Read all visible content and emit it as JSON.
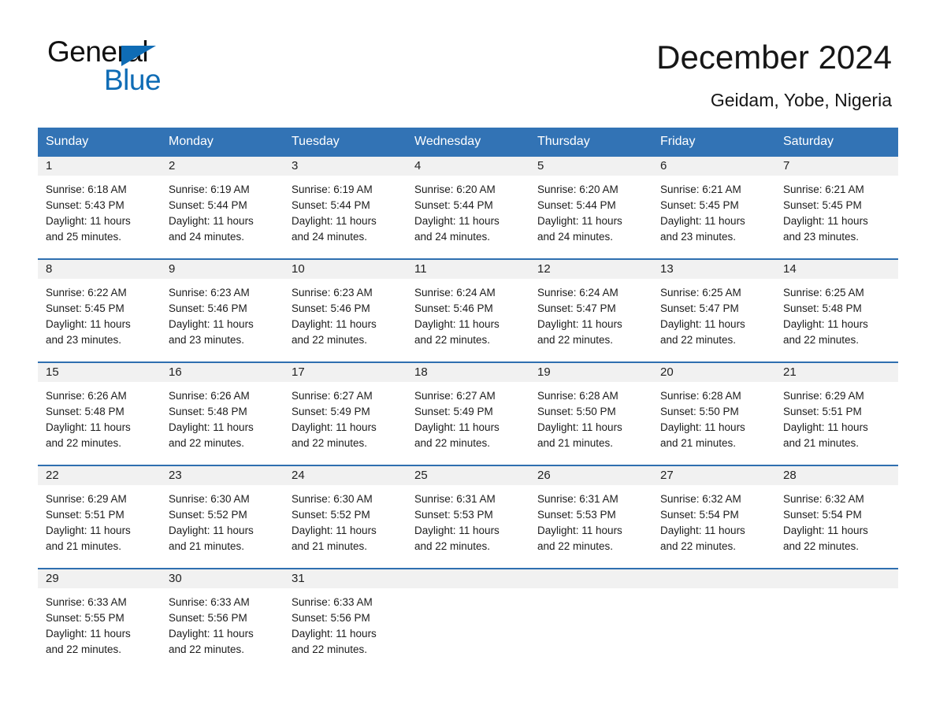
{
  "brand": {
    "name_part1": "General",
    "name_part2": "Blue",
    "accent_color": "#0f6cb5"
  },
  "header": {
    "title": "December 2024",
    "subtitle": "Geidam, Yobe, Nigeria"
  },
  "calendar": {
    "header_bg": "#3273b5",
    "header_text_color": "#ffffff",
    "row_border_color": "#2f6fb0",
    "daynum_bg": "#f1f1f1",
    "weekdays": [
      "Sunday",
      "Monday",
      "Tuesday",
      "Wednesday",
      "Thursday",
      "Friday",
      "Saturday"
    ],
    "weeks": [
      [
        {
          "day": "1",
          "sunrise": "Sunrise: 6:18 AM",
          "sunset": "Sunset: 5:43 PM",
          "daylight_1": "Daylight: 11 hours",
          "daylight_2": "and 25 minutes."
        },
        {
          "day": "2",
          "sunrise": "Sunrise: 6:19 AM",
          "sunset": "Sunset: 5:44 PM",
          "daylight_1": "Daylight: 11 hours",
          "daylight_2": "and 24 minutes."
        },
        {
          "day": "3",
          "sunrise": "Sunrise: 6:19 AM",
          "sunset": "Sunset: 5:44 PM",
          "daylight_1": "Daylight: 11 hours",
          "daylight_2": "and 24 minutes."
        },
        {
          "day": "4",
          "sunrise": "Sunrise: 6:20 AM",
          "sunset": "Sunset: 5:44 PM",
          "daylight_1": "Daylight: 11 hours",
          "daylight_2": "and 24 minutes."
        },
        {
          "day": "5",
          "sunrise": "Sunrise: 6:20 AM",
          "sunset": "Sunset: 5:44 PM",
          "daylight_1": "Daylight: 11 hours",
          "daylight_2": "and 24 minutes."
        },
        {
          "day": "6",
          "sunrise": "Sunrise: 6:21 AM",
          "sunset": "Sunset: 5:45 PM",
          "daylight_1": "Daylight: 11 hours",
          "daylight_2": "and 23 minutes."
        },
        {
          "day": "7",
          "sunrise": "Sunrise: 6:21 AM",
          "sunset": "Sunset: 5:45 PM",
          "daylight_1": "Daylight: 11 hours",
          "daylight_2": "and 23 minutes."
        }
      ],
      [
        {
          "day": "8",
          "sunrise": "Sunrise: 6:22 AM",
          "sunset": "Sunset: 5:45 PM",
          "daylight_1": "Daylight: 11 hours",
          "daylight_2": "and 23 minutes."
        },
        {
          "day": "9",
          "sunrise": "Sunrise: 6:23 AM",
          "sunset": "Sunset: 5:46 PM",
          "daylight_1": "Daylight: 11 hours",
          "daylight_2": "and 23 minutes."
        },
        {
          "day": "10",
          "sunrise": "Sunrise: 6:23 AM",
          "sunset": "Sunset: 5:46 PM",
          "daylight_1": "Daylight: 11 hours",
          "daylight_2": "and 22 minutes."
        },
        {
          "day": "11",
          "sunrise": "Sunrise: 6:24 AM",
          "sunset": "Sunset: 5:46 PM",
          "daylight_1": "Daylight: 11 hours",
          "daylight_2": "and 22 minutes."
        },
        {
          "day": "12",
          "sunrise": "Sunrise: 6:24 AM",
          "sunset": "Sunset: 5:47 PM",
          "daylight_1": "Daylight: 11 hours",
          "daylight_2": "and 22 minutes."
        },
        {
          "day": "13",
          "sunrise": "Sunrise: 6:25 AM",
          "sunset": "Sunset: 5:47 PM",
          "daylight_1": "Daylight: 11 hours",
          "daylight_2": "and 22 minutes."
        },
        {
          "day": "14",
          "sunrise": "Sunrise: 6:25 AM",
          "sunset": "Sunset: 5:48 PM",
          "daylight_1": "Daylight: 11 hours",
          "daylight_2": "and 22 minutes."
        }
      ],
      [
        {
          "day": "15",
          "sunrise": "Sunrise: 6:26 AM",
          "sunset": "Sunset: 5:48 PM",
          "daylight_1": "Daylight: 11 hours",
          "daylight_2": "and 22 minutes."
        },
        {
          "day": "16",
          "sunrise": "Sunrise: 6:26 AM",
          "sunset": "Sunset: 5:48 PM",
          "daylight_1": "Daylight: 11 hours",
          "daylight_2": "and 22 minutes."
        },
        {
          "day": "17",
          "sunrise": "Sunrise: 6:27 AM",
          "sunset": "Sunset: 5:49 PM",
          "daylight_1": "Daylight: 11 hours",
          "daylight_2": "and 22 minutes."
        },
        {
          "day": "18",
          "sunrise": "Sunrise: 6:27 AM",
          "sunset": "Sunset: 5:49 PM",
          "daylight_1": "Daylight: 11 hours",
          "daylight_2": "and 22 minutes."
        },
        {
          "day": "19",
          "sunrise": "Sunrise: 6:28 AM",
          "sunset": "Sunset: 5:50 PM",
          "daylight_1": "Daylight: 11 hours",
          "daylight_2": "and 21 minutes."
        },
        {
          "day": "20",
          "sunrise": "Sunrise: 6:28 AM",
          "sunset": "Sunset: 5:50 PM",
          "daylight_1": "Daylight: 11 hours",
          "daylight_2": "and 21 minutes."
        },
        {
          "day": "21",
          "sunrise": "Sunrise: 6:29 AM",
          "sunset": "Sunset: 5:51 PM",
          "daylight_1": "Daylight: 11 hours",
          "daylight_2": "and 21 minutes."
        }
      ],
      [
        {
          "day": "22",
          "sunrise": "Sunrise: 6:29 AM",
          "sunset": "Sunset: 5:51 PM",
          "daylight_1": "Daylight: 11 hours",
          "daylight_2": "and 21 minutes."
        },
        {
          "day": "23",
          "sunrise": "Sunrise: 6:30 AM",
          "sunset": "Sunset: 5:52 PM",
          "daylight_1": "Daylight: 11 hours",
          "daylight_2": "and 21 minutes."
        },
        {
          "day": "24",
          "sunrise": "Sunrise: 6:30 AM",
          "sunset": "Sunset: 5:52 PM",
          "daylight_1": "Daylight: 11 hours",
          "daylight_2": "and 21 minutes."
        },
        {
          "day": "25",
          "sunrise": "Sunrise: 6:31 AM",
          "sunset": "Sunset: 5:53 PM",
          "daylight_1": "Daylight: 11 hours",
          "daylight_2": "and 22 minutes."
        },
        {
          "day": "26",
          "sunrise": "Sunrise: 6:31 AM",
          "sunset": "Sunset: 5:53 PM",
          "daylight_1": "Daylight: 11 hours",
          "daylight_2": "and 22 minutes."
        },
        {
          "day": "27",
          "sunrise": "Sunrise: 6:32 AM",
          "sunset": "Sunset: 5:54 PM",
          "daylight_1": "Daylight: 11 hours",
          "daylight_2": "and 22 minutes."
        },
        {
          "day": "28",
          "sunrise": "Sunrise: 6:32 AM",
          "sunset": "Sunset: 5:54 PM",
          "daylight_1": "Daylight: 11 hours",
          "daylight_2": "and 22 minutes."
        }
      ],
      [
        {
          "day": "29",
          "sunrise": "Sunrise: 6:33 AM",
          "sunset": "Sunset: 5:55 PM",
          "daylight_1": "Daylight: 11 hours",
          "daylight_2": "and 22 minutes."
        },
        {
          "day": "30",
          "sunrise": "Sunrise: 6:33 AM",
          "sunset": "Sunset: 5:56 PM",
          "daylight_1": "Daylight: 11 hours",
          "daylight_2": "and 22 minutes."
        },
        {
          "day": "31",
          "sunrise": "Sunrise: 6:33 AM",
          "sunset": "Sunset: 5:56 PM",
          "daylight_1": "Daylight: 11 hours",
          "daylight_2": "and 22 minutes."
        },
        {
          "day": "",
          "sunrise": "",
          "sunset": "",
          "daylight_1": "",
          "daylight_2": ""
        },
        {
          "day": "",
          "sunrise": "",
          "sunset": "",
          "daylight_1": "",
          "daylight_2": ""
        },
        {
          "day": "",
          "sunrise": "",
          "sunset": "",
          "daylight_1": "",
          "daylight_2": ""
        },
        {
          "day": "",
          "sunrise": "",
          "sunset": "",
          "daylight_1": "",
          "daylight_2": ""
        }
      ]
    ]
  }
}
